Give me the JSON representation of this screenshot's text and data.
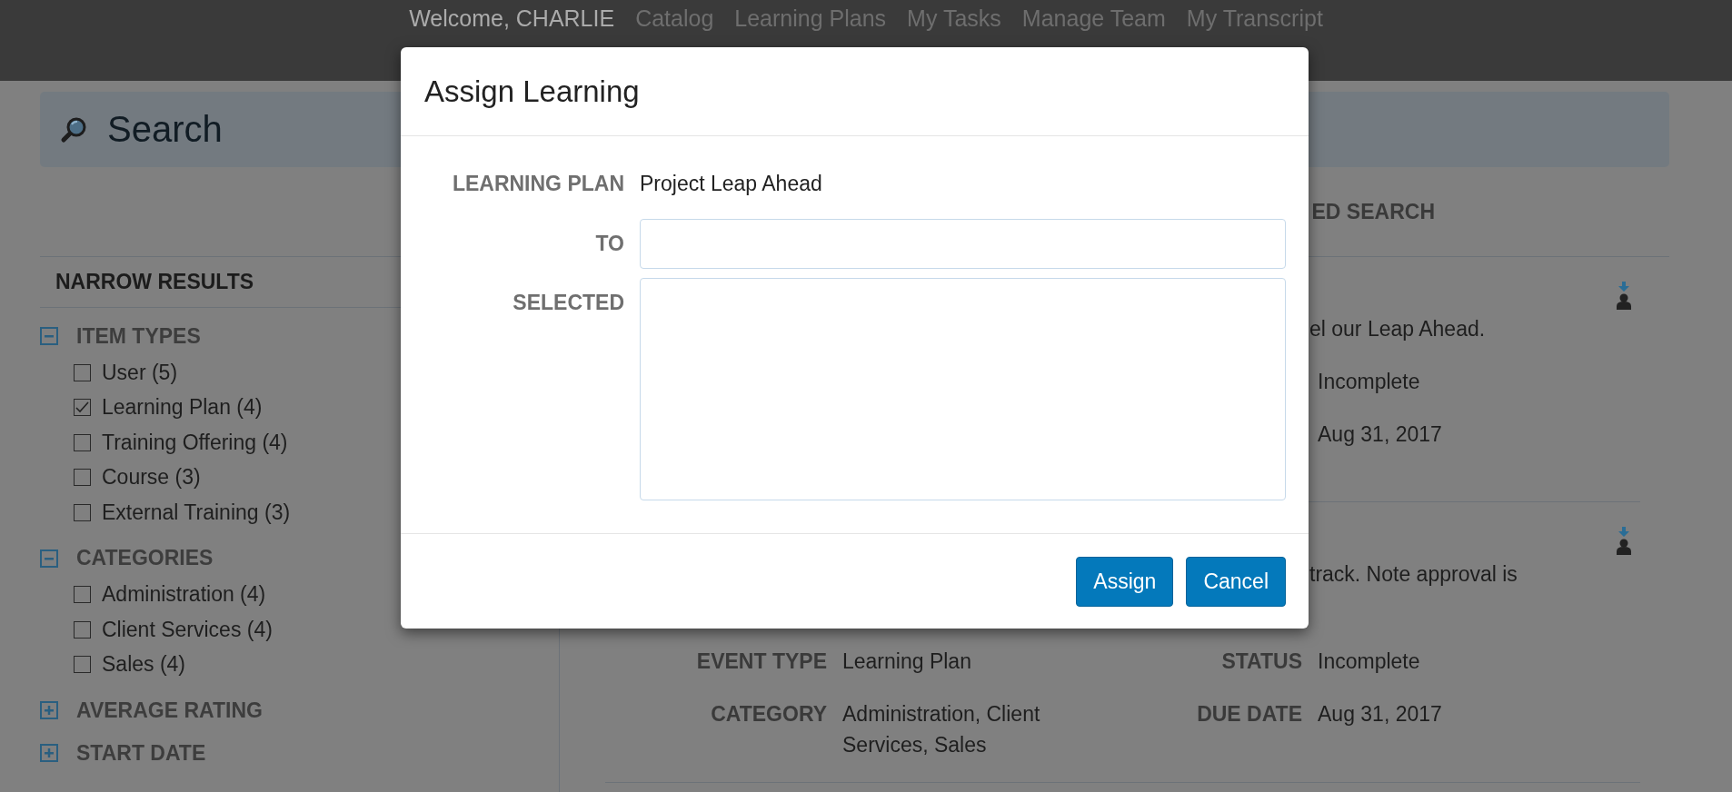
{
  "nav": {
    "welcome": "Welcome, CHARLIE",
    "links": [
      {
        "label": "Catalog"
      },
      {
        "label": "Learning Plans"
      },
      {
        "label": "My Tasks"
      },
      {
        "label": "Manage Team"
      },
      {
        "label": "My Transcript"
      }
    ]
  },
  "search": {
    "title": "Search"
  },
  "filters": {
    "title": "NARROW RESULTS",
    "groups": [
      {
        "label": "ITEM TYPES",
        "expanded": true,
        "options": [
          {
            "label": "User (5)",
            "checked": false
          },
          {
            "label": "Learning Plan (4)",
            "checked": true
          },
          {
            "label": "Training Offering (4)",
            "checked": false
          },
          {
            "label": "Course (3)",
            "checked": false
          },
          {
            "label": "External Training (3)",
            "checked": false
          }
        ]
      },
      {
        "label": "CATEGORIES",
        "expanded": true,
        "options": [
          {
            "label": "Administration (4)",
            "checked": false
          },
          {
            "label": "Client Services (4)",
            "checked": false
          },
          {
            "label": "Sales (4)",
            "checked": false
          }
        ]
      },
      {
        "label": "AVERAGE RATING",
        "expanded": false
      },
      {
        "label": "START DATE",
        "expanded": false
      }
    ]
  },
  "results": {
    "advanced_search": "ED SEARCH",
    "items": [
      {
        "description": "el our Leap Ahead.",
        "rows": [
          {
            "right": {
              "value": "Incomplete"
            }
          },
          {
            "right": {
              "value": "Aug 31, 2017"
            }
          }
        ]
      },
      {
        "description": "track. Note approval is",
        "rows": [
          {
            "left": {
              "label": "EVENT TYPE",
              "value": "Learning Plan"
            },
            "right": {
              "label": "STATUS",
              "value": "Incomplete"
            }
          },
          {
            "left": {
              "label": "CATEGORY",
              "value": "Administration, Client Services, Sales"
            },
            "right": {
              "label": "DUE DATE",
              "value": "Aug 31, 2017"
            }
          }
        ]
      }
    ]
  },
  "dialog": {
    "title": "Assign Learning",
    "fields": [
      {
        "kind": "text",
        "label": "LEARNING PLAN",
        "value": "Project Leap Ahead"
      },
      {
        "kind": "input",
        "label": "TO"
      },
      {
        "kind": "textarea",
        "label": "SELECTED"
      }
    ],
    "buttons": [
      {
        "label": "Assign"
      },
      {
        "label": "Cancel"
      }
    ]
  }
}
